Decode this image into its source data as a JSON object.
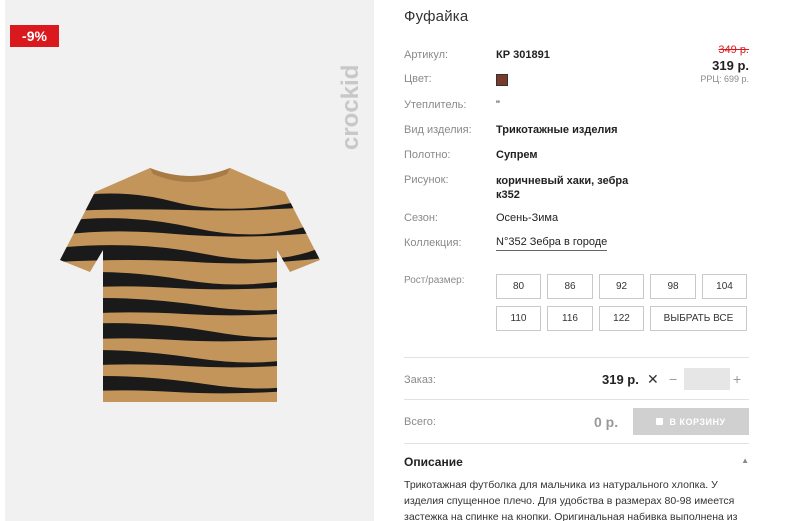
{
  "badge": {
    "discount": "-9%"
  },
  "brand": {
    "logo_text": "crockid"
  },
  "product": {
    "title": "Фуфайка",
    "specs": [
      {
        "label": "Артикул:",
        "value": "КР 301891"
      },
      {
        "label": "Цвет:",
        "value": ""
      },
      {
        "label": "Утеплитель:",
        "value": "\""
      },
      {
        "label": "Вид изделия:",
        "value": "Трикотажные изделия"
      },
      {
        "label": "Полотно:",
        "value": "Супрем"
      },
      {
        "label": "Рисунок:",
        "value": "коричневый хаки, зебра к352"
      },
      {
        "label": "Сезон:",
        "value": "Осень-Зима"
      },
      {
        "label": "Коллекция:",
        "value": "N°352 Зебра в городе"
      }
    ],
    "color_hex": "#7a3b2a"
  },
  "price": {
    "old": "349 р.",
    "new": "319 р.",
    "rrp": "РРЦ: 699 р."
  },
  "sizes": {
    "label": "Рост/размер:",
    "options": [
      "80",
      "86",
      "92",
      "98",
      "104",
      "110",
      "116",
      "122"
    ],
    "select_all": "ВЫБРАТЬ ВСЕ"
  },
  "order": {
    "label": "Заказ:",
    "price": "319 р.",
    "clear": "✕",
    "minus": "−",
    "plus": "+",
    "quantity": ""
  },
  "total": {
    "label": "Всего:",
    "value": "0 р.",
    "cart_button": "В КОРЗИНУ"
  },
  "description": {
    "title": "Описание",
    "toggle": "▲",
    "text": "Трикотажная футболка для мальчика из натурального хлопка. У изделия спущенное плечо. Для удобства в размерах 80-98 имеется застежка на спинке на кнопки. Оригинальная набивка выполнена из"
  },
  "colors": {
    "accent": "#d9191e",
    "button_disabled": "#d0d0d0",
    "image_bg": "#f1f1f1"
  }
}
